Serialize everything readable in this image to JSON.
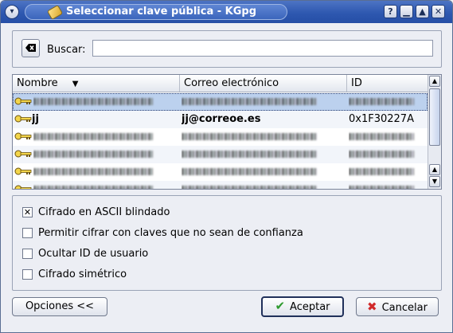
{
  "window": {
    "title": "Seleccionar clave pública - KGpg",
    "buttons": {
      "help": "?",
      "minimize": "▁",
      "maximize": "▲",
      "close": "✕"
    },
    "menu_glyph": "▾"
  },
  "search": {
    "label": "Buscar:",
    "value": "",
    "clear_icon": "clear-location-icon"
  },
  "table": {
    "columns": [
      "Nombre",
      "Correo electrónico",
      "ID"
    ],
    "sort_indicator": "▼",
    "rows": [
      {
        "name": "",
        "email": "",
        "id": "",
        "obscured": true
      },
      {
        "name": "jj",
        "email": "jj@correoe.es",
        "id": "0x1F30227A",
        "obscured": false
      },
      {
        "name": "",
        "email": "",
        "id": "",
        "obscured": true
      },
      {
        "name": "",
        "email": "",
        "id": "",
        "obscured": true
      },
      {
        "name": "",
        "email": "",
        "id": "",
        "obscured": true
      },
      {
        "name": "",
        "email": "",
        "id": "",
        "obscured": true
      }
    ]
  },
  "options": {
    "items": [
      {
        "label": "Cifrado en ASCII blindado",
        "checked": true
      },
      {
        "label": "Permitir cifrar con claves que no sean de confianza",
        "checked": false
      },
      {
        "label": "Ocultar ID de usuario",
        "checked": false
      },
      {
        "label": "Cifrado simétrico",
        "checked": false
      }
    ]
  },
  "buttons": {
    "options": "Opciones <<",
    "accept": "Aceptar",
    "cancel": "Cancelar"
  },
  "colors": {
    "titlebar": "#2e58b0",
    "selected_row": "#bcd1ee",
    "accept_icon": "#2e9a2e",
    "cancel_icon": "#d12a2a"
  }
}
